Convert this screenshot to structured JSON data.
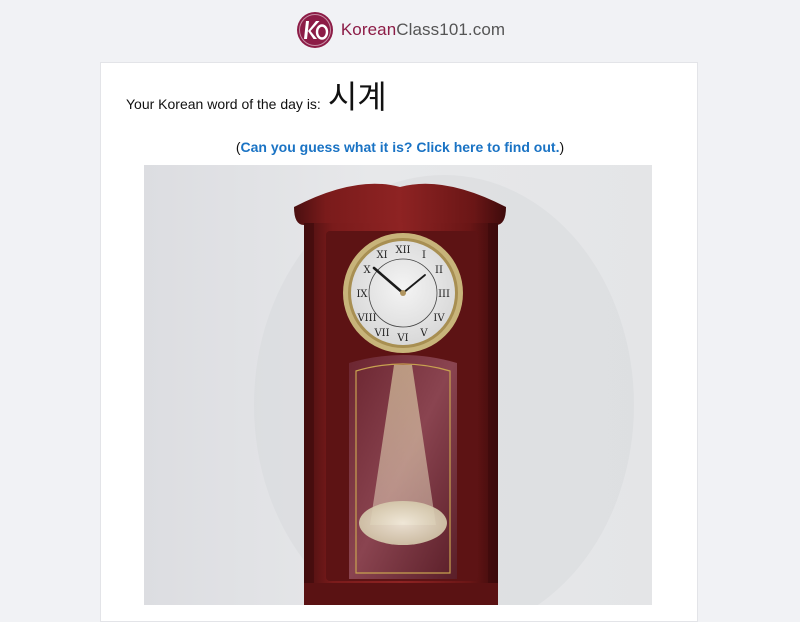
{
  "brand": {
    "name_part1": "Korean",
    "name_part2": "Class101.com",
    "logo_icon": "ko-monogram-icon",
    "accent_color": "#8c1c46"
  },
  "word_of_day": {
    "label": "Your Korean word of the day is:",
    "word": "시계"
  },
  "hint": {
    "open_paren": "(",
    "link_text": "Can you guess what it is? Click here to find out.",
    "close_paren": ")",
    "link_color": "#1a73c4"
  },
  "image": {
    "subject": "pendulum-wall-clock-image"
  }
}
